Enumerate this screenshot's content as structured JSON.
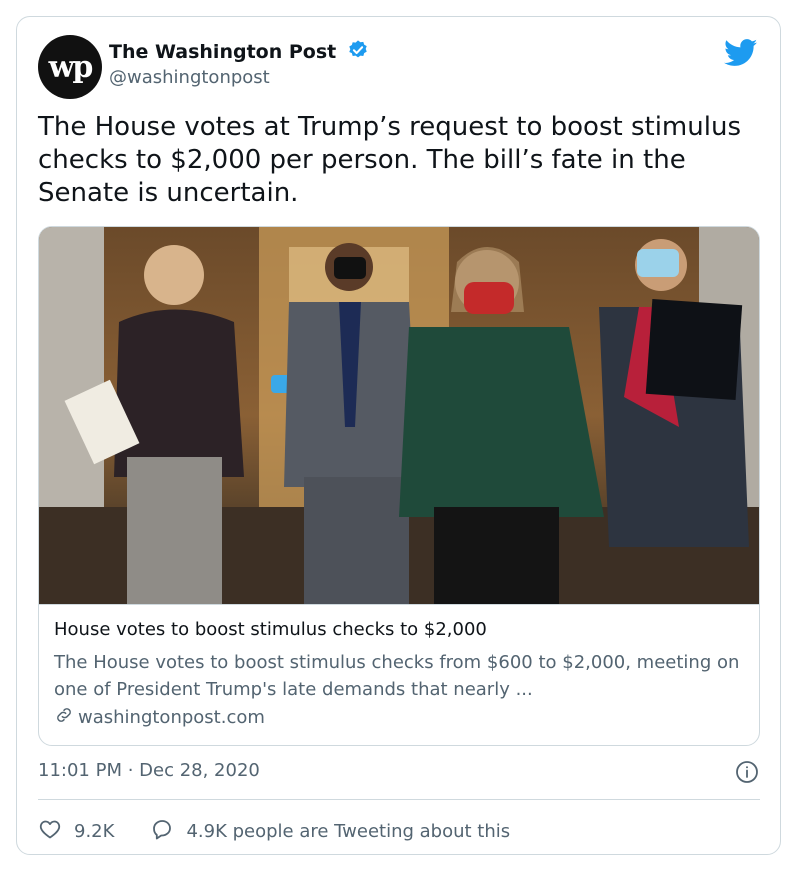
{
  "author": {
    "name": "The Washington Post",
    "handle": "@washingtonpost",
    "avatar_text": "wp",
    "verified": true
  },
  "tweet": {
    "text": "The House votes at Trump’s request to boost stimulus checks to $2,000 per person. The bill’s fate in the Senate is uncertain."
  },
  "link_card": {
    "title": "House votes to boost stimulus checks to $2,000",
    "description": "The House votes to boost stimulus checks from $600 to $2,000, meeting on one of President Trump's late demands that nearly ...",
    "domain": "washingtonpost.com"
  },
  "meta": {
    "timestamp": "11:01 PM · Dec 28, 2020"
  },
  "actions": {
    "likes": "9.2K",
    "replies_label": "4.9K people are Tweeting about this"
  },
  "colors": {
    "twitter_blue": "#1d9bf0",
    "muted_text": "#536471",
    "border": "#cfd9de"
  }
}
